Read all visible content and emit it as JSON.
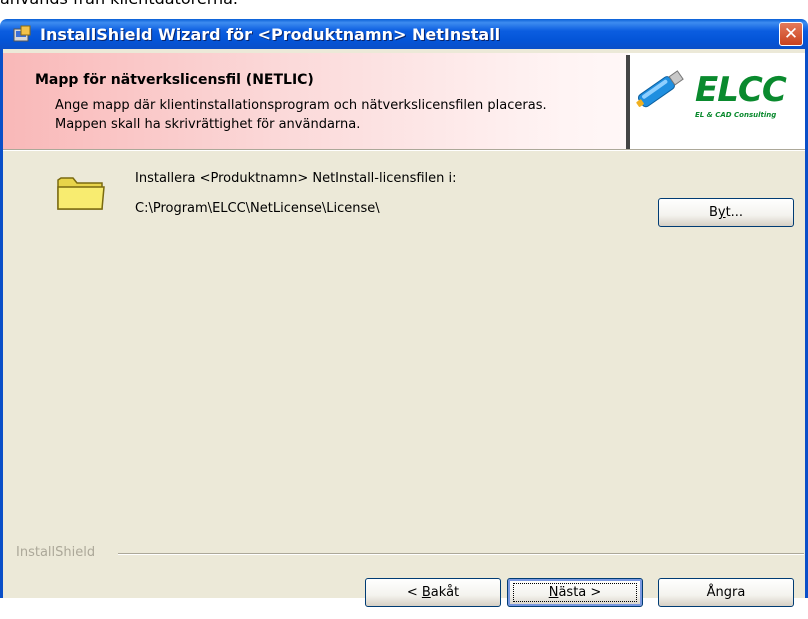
{
  "background_text": "används från klientdatorerna.",
  "window": {
    "title": "InstallShield Wizard för <Produktnamn> NetInstall",
    "close_glyph": "✕"
  },
  "header": {
    "title": "Mapp för nätverkslicensfil (NETLIC)",
    "description_line1": "Ange mapp där klientinstallationsprogram och nätverkslicensfilen placeras.",
    "description_line2": "Mappen skall ha skrivrättighet för användarna.",
    "logo_text": "ELCC",
    "logo_subtitle": "EL & CAD Consulting"
  },
  "body": {
    "install_label": "Installera <Produktnamn> NetInstall-licensfilen i:",
    "install_path": "C:\\Program\\ELCC\\NetLicense\\License\\",
    "change_button": {
      "pre": "B",
      "accel": "y",
      "post": "t..."
    }
  },
  "footer": {
    "brand": "InstallShield",
    "back_button": {
      "pre": "< ",
      "accel": "B",
      "post": "akåt"
    },
    "next_button": {
      "pre": "",
      "accel": "N",
      "post": "ästa >"
    },
    "cancel_button": "Ångra"
  },
  "colors": {
    "titlebar": "#0455d8",
    "dialog_bg": "#ece9d8",
    "logo_green": "#0a8a2e",
    "header_gradient_start": "#f9b8b8"
  }
}
